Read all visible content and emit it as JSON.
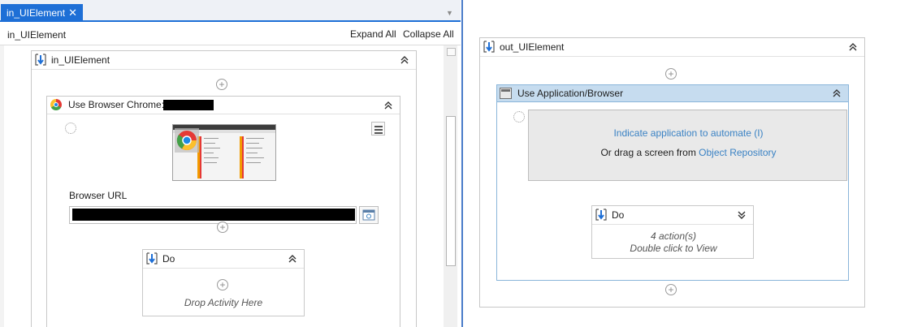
{
  "tab": {
    "title": "in_UIElement",
    "close": "✕"
  },
  "header": {
    "breadcrumb": "in_UIElement",
    "expand_all": "Expand All",
    "collapse_all": "Collapse All"
  },
  "left": {
    "sequence_title": "in_UIElement",
    "browser_activity": {
      "title": "Use Browser Chrome:",
      "url_label": "Browser URL"
    },
    "do_block": {
      "title": "Do",
      "drop_hint": "Drop Activity Here"
    }
  },
  "right": {
    "sequence_title": "out_UIElement",
    "app_activity": {
      "title": "Use Application/Browser",
      "indicate_link": "Indicate application to automate (I)",
      "drag_prefix": "Or drag a screen from",
      "drag_link": "Object Repository"
    },
    "do_block": {
      "title": "Do",
      "actions": "4 action(s)",
      "hint": "Double click to View"
    }
  },
  "icons": {
    "sequence": "sequence-icon",
    "collapse": "double-chevron-up-icon",
    "expand": "double-chevron-down-icon",
    "add": "plus-circle-icon",
    "target": "target-icon",
    "menu": "hamburger-icon",
    "browser": "chrome-icon"
  },
  "colors": {
    "tab_accent": "#1e6fd6",
    "link": "#3a82c4",
    "activity_header": "#c6dcef"
  }
}
